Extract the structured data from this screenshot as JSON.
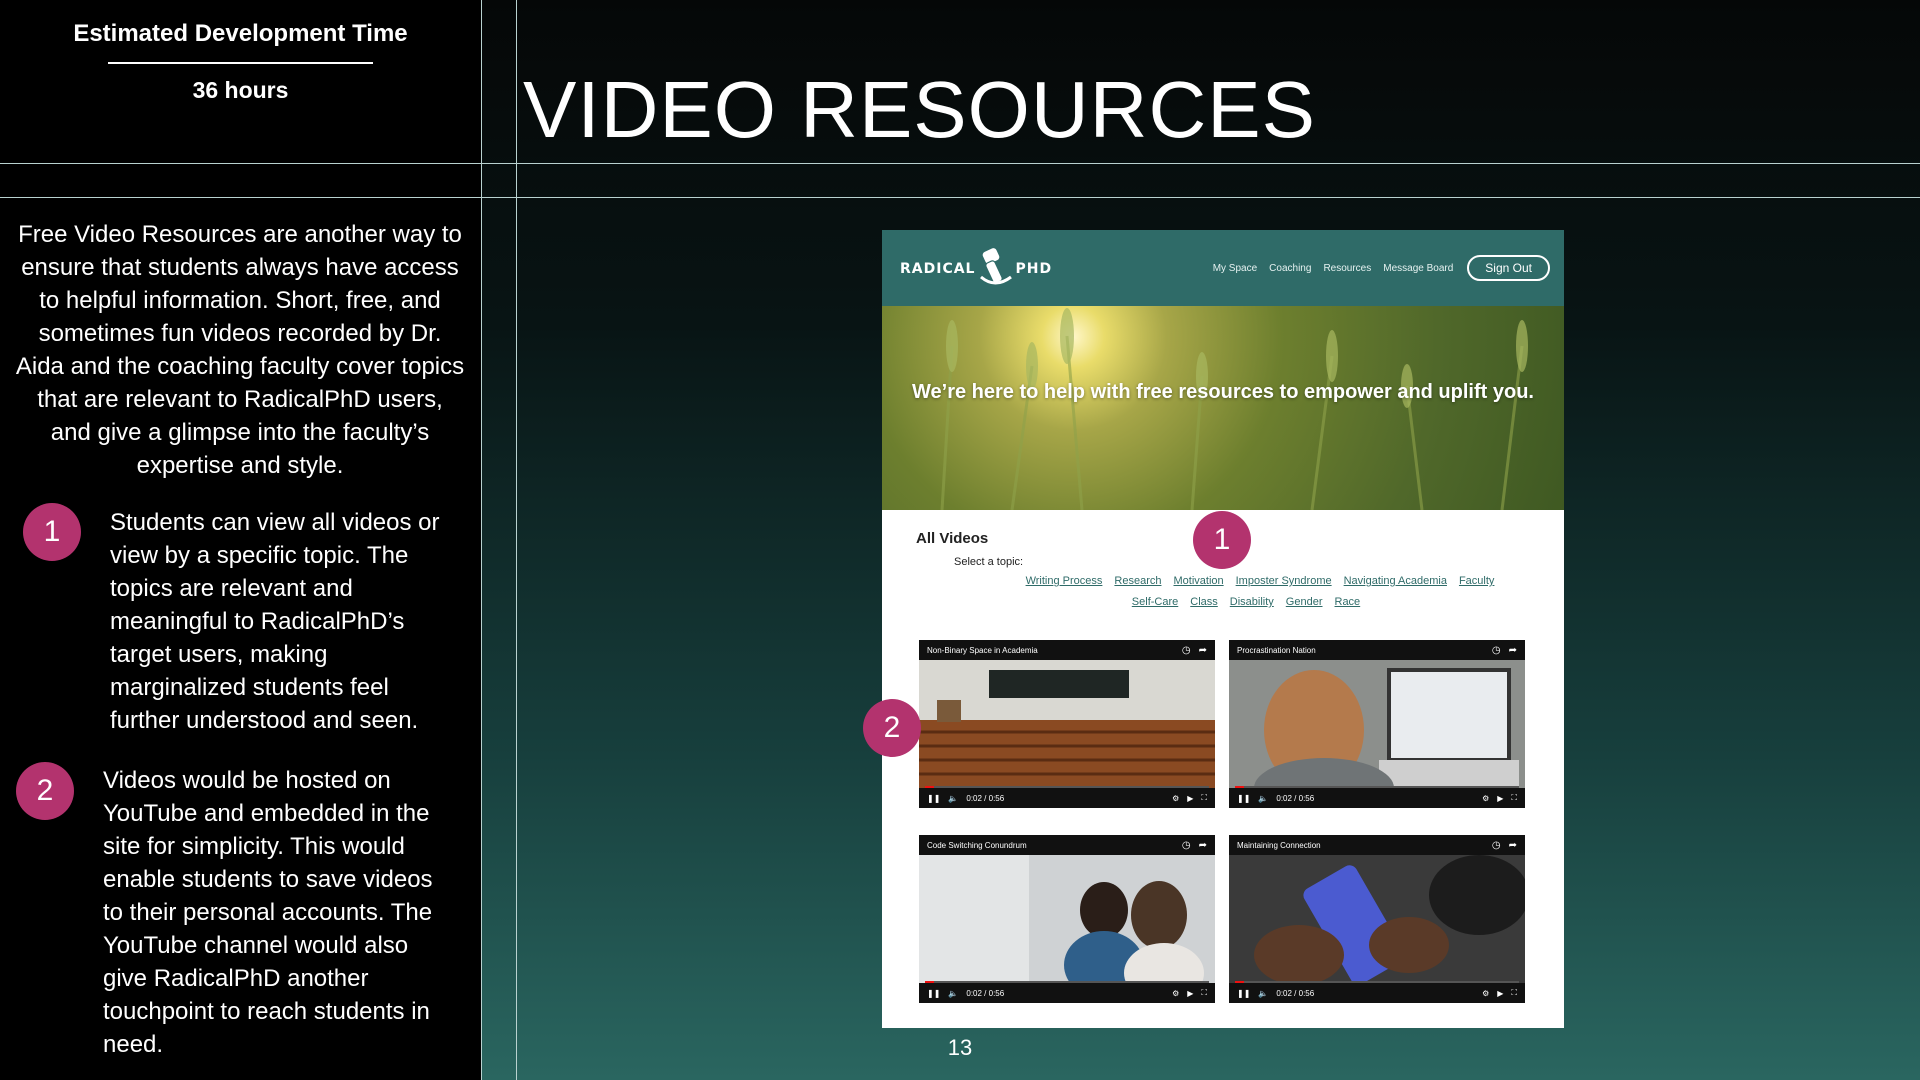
{
  "sidebar": {
    "estimate_title": "Estimated Development Time",
    "estimate_value": "36 hours",
    "intro": "Free Video Resources are another way to ensure that students always have access to helpful information. Short, free, and sometimes fun videos recorded by Dr. Aida and the coaching faculty cover topics that are relevant to RadicalPhD users, and give a glimpse into the faculty’s expertise and style.",
    "points": [
      {
        "number": "1",
        "text": "Students can view all videos or view by a specific topic. The topics are relevant and meaningful to RadicalPhD’s target users, making marginalized students feel further understood and seen."
      },
      {
        "number": "2",
        "text": "Videos would be hosted on YouTube and embedded in the site for simplicity. This would enable students to save videos to their personal accounts. The YouTube channel would also give RadicalPhD another touchpoint to reach students in need."
      }
    ]
  },
  "slide": {
    "title": "VIDEO RESOURCES",
    "page_number": "13"
  },
  "mockup": {
    "logo_left": "RADICAL",
    "logo_right": "PHD",
    "nav": [
      "My Space",
      "Coaching",
      "Resources",
      "Message Board"
    ],
    "signout": "Sign Out",
    "hero_headline": "We’re here to help with free resources to empower and uplift you.",
    "all_videos": "All Videos",
    "select_topic": "Select a topic:",
    "topics_row1": [
      "Writing Process",
      "Research",
      "Motivation",
      "Imposter Syndrome",
      "Navigating Academia",
      "Faculty"
    ],
    "topics_row2": [
      "Self-Care",
      "Class",
      "Disability",
      "Gender",
      "Race"
    ],
    "videos": [
      {
        "title": "Non-Binary Space in Academia",
        "time": "0:02 / 0:56"
      },
      {
        "title": "Procrastination Nation",
        "time": "0:02 / 0:56"
      },
      {
        "title": "Code Switching Conundrum",
        "time": "0:02 / 0:56"
      },
      {
        "title": "Maintaining Connection",
        "time": "0:02 / 0:56"
      }
    ],
    "callouts": [
      "1",
      "2"
    ],
    "colors": {
      "header": "#2f6b68",
      "badge": "#b3336e"
    }
  }
}
